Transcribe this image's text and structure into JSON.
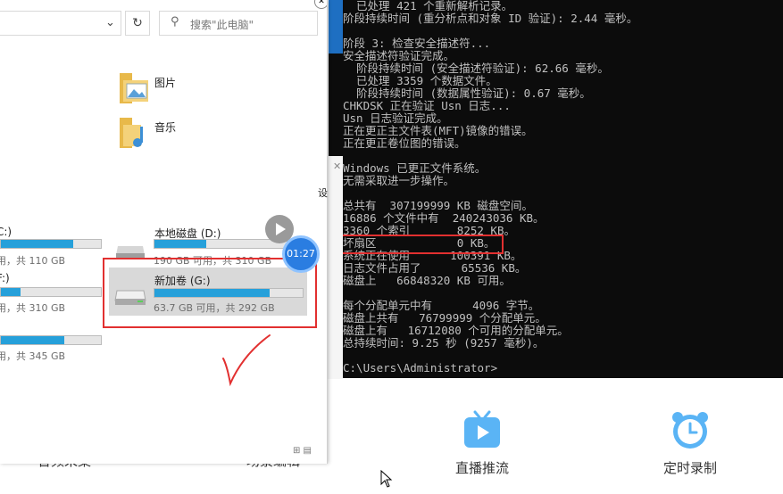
{
  "explorer": {
    "search_placeholder": "搜索\"此电脑\"",
    "refresh_glyph": "↻",
    "chevron_glyph": "⌄",
    "folders": [
      {
        "label": "图片",
        "icon": "pictures-folder-icon"
      },
      {
        "label": "音乐",
        "icon": "music-folder-icon"
      }
    ],
    "drives": [
      {
        "name": "C:)",
        "info": "用，共 110 GB",
        "fill": 0.72
      },
      {
        "name": "本地磁盘 (D:)",
        "info": "190 GB 可用，共 310 GB",
        "fill": 0.39
      },
      {
        "name": "F:)",
        "info": "用，共 310 GB",
        "fill": 0.2
      },
      {
        "name": "新加卷 (G:)",
        "info": "63.7 GB 可用，共 292 GB",
        "fill": 0.78
      },
      {
        "name": "",
        "info": "用，共 345 GB",
        "fill": 0.63
      }
    ],
    "side_text": "设",
    "view_icons": "⊞ ▤"
  },
  "overlay": {
    "timer": "01:27"
  },
  "console": {
    "lines": [
      "  已处理 421 个重新解析记录。",
      "阶段持续时间 (重分析点和对象 ID 验证): 2.44 毫秒。",
      "",
      "阶段 3: 检查安全描述符...",
      "安全描述符验证完成。",
      "  阶段持续时间 (安全描述符验证): 62.66 毫秒。",
      "  已处理 3359 个数据文件。",
      "  阶段持续时间 (数据属性验证): 0.67 毫秒。",
      "CHKDSK 正在验证 Usn 日志...",
      "Usn 日志验证完成。",
      "正在更正主文件表(MFT)镜像的错误。",
      "正在更正卷位图的错误。",
      "",
      "Windows 已更正文件系统。",
      "无需采取进一步操作。",
      "",
      "总共有  307199999 KB 磁盘空间。",
      "16886 个文件中有  240243036 KB。",
      "3360 个索引       8252 KB。",
      "坏扇区            0 KB。",
      "系统正在使用      100391 KB。",
      "日志文件占用了      65536 KB。",
      "磁盘上   66848320 KB 可用。",
      "",
      "每个分配单元中有      4096 字节。",
      "磁盘上共有   76799999 个分配单元。",
      "磁盘上有   16712080 个可用的分配单元。",
      "总持续时间: 9.25 秒 (9257 毫秒)。",
      "",
      "C:\\Users\\Administrator>"
    ]
  },
  "toolbar": {
    "items": [
      {
        "label": "音频采集"
      },
      {
        "label": "场景编辑"
      },
      {
        "label": "直播推流",
        "icon": "live-tv-icon"
      },
      {
        "label": "定时录制",
        "icon": "alarm-clock-icon"
      }
    ]
  }
}
